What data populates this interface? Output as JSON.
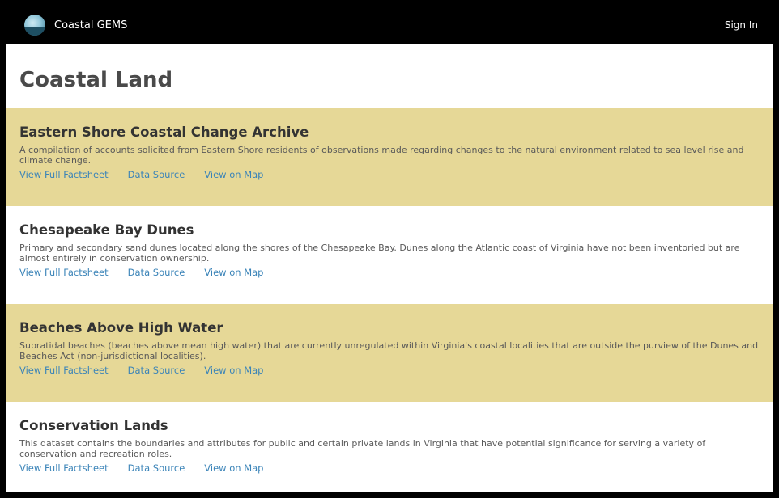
{
  "header": {
    "logo_icon": "coastal-gems-logo",
    "app_name": "Coastal GEMS",
    "sign_in": "Sign In"
  },
  "page": {
    "title": "Coastal Land"
  },
  "colors": {
    "topbar": "#000000",
    "shaded_card": "#e6d897",
    "link": "#3b84b8",
    "title_text": "#333333"
  },
  "cards": [
    {
      "title": "Eastern Shore Coastal Change Archive",
      "description": "A compilation of accounts solicited from Eastern Shore residents of observations made regarding changes to the natural environment related to sea level rise and climate change.",
      "links": [
        "View Full Factsheet",
        "Data Source",
        "View on Map"
      ],
      "shaded": true
    },
    {
      "title": "Chesapeake Bay Dunes",
      "description": "Primary and secondary sand dunes located along the shores of the Chesapeake Bay. Dunes along the Atlantic coast of Virginia have not been inventoried but are almost entirely in conservation ownership.",
      "links": [
        "View Full Factsheet",
        "Data Source",
        "View on Map"
      ],
      "shaded": false
    },
    {
      "title": "Beaches Above High Water",
      "description": "Supratidal beaches (beaches above mean high water) that are currently unregulated within Virginia's coastal localities that are outside the purview of the Dunes and Beaches Act (non-jurisdictional localities).",
      "links": [
        "View Full Factsheet",
        "Data Source",
        "View on Map"
      ],
      "shaded": true
    },
    {
      "title": "Conservation Lands",
      "description": "This dataset contains the boundaries and attributes for public and certain private lands in Virginia that have potential significance for serving a variety of conservation and recreation roles.",
      "links": [
        "View Full Factsheet",
        "Data Source",
        "View on Map"
      ],
      "shaded": false
    }
  ]
}
